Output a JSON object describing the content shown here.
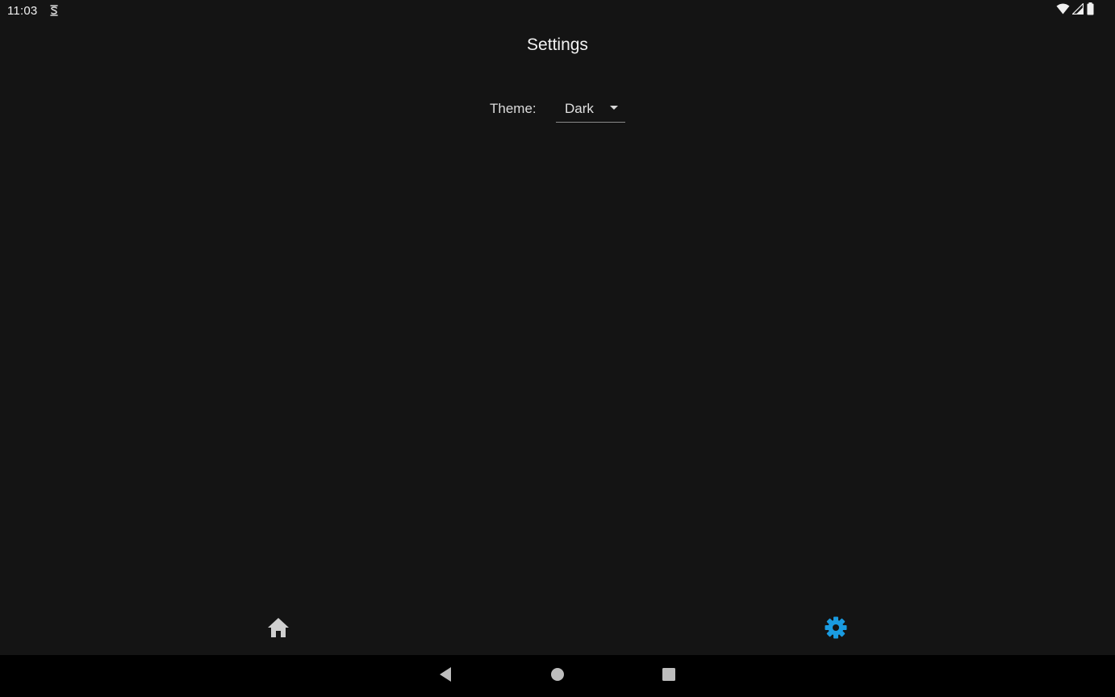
{
  "status_bar": {
    "time": "11:03"
  },
  "page": {
    "title": "Settings"
  },
  "theme_setting": {
    "label": "Theme:",
    "selected_value": "Dark"
  },
  "bottom_nav": {
    "items": [
      {
        "icon": "home-icon",
        "active": false
      },
      {
        "icon": "gear-icon",
        "active": true
      }
    ],
    "active_color": "#1a9be0",
    "inactive_color": "#cfcfcf"
  },
  "colors": {
    "background": "#141414",
    "system_nav_background": "#000000"
  }
}
